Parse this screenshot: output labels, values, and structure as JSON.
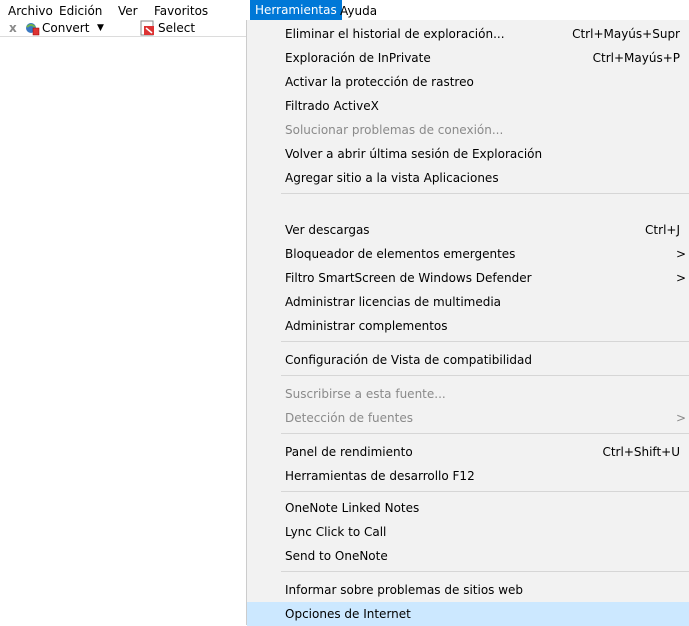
{
  "menubar": {
    "items": [
      "Archivo",
      "Edición",
      "Ver",
      "Favoritos",
      "Herramientas",
      "Ayuda"
    ]
  },
  "commandbar": {
    "close_glyph": "x",
    "convert_label": "Convert",
    "select_label": "Select",
    "convert_icon": "convert-icon",
    "select_icon": "select-icon"
  },
  "menu": {
    "items": [
      {
        "label": "Eliminar el historial de exploración...",
        "shortcut": "Ctrl+Mayús+Supr"
      },
      {
        "label": "Exploración de InPrivate",
        "shortcut": "Ctrl+Mayús+P"
      },
      {
        "label": "Activar la protección de rastreo",
        "shortcut": ""
      },
      {
        "label": "Filtrado ActiveX",
        "shortcut": ""
      },
      {
        "label": "Solucionar problemas de conexión...",
        "shortcut": "",
        "disabled": true
      },
      {
        "label": "Volver a abrir última sesión de Exploración",
        "shortcut": ""
      },
      {
        "label": "Agregar sitio a la vista Aplicaciones",
        "shortcut": ""
      },
      {
        "label": "Ver descargas",
        "shortcut": "Ctrl+J"
      },
      {
        "label": "Bloqueador de elementos emergentes",
        "shortcut": "",
        "submenu": true
      },
      {
        "label": "Filtro SmartScreen de Windows Defender",
        "shortcut": "",
        "submenu": true
      },
      {
        "label": "Administrar licencias de multimedia",
        "shortcut": ""
      },
      {
        "label": "Administrar complementos",
        "shortcut": ""
      },
      {
        "label": "Configuración de Vista de compatibilidad",
        "shortcut": ""
      },
      {
        "label": "Suscribirse a esta fuente...",
        "shortcut": "",
        "disabled": true
      },
      {
        "label": "Detección de fuentes",
        "shortcut": "",
        "disabled": true,
        "submenu": true
      },
      {
        "label": "Panel de rendimiento",
        "shortcut": "Ctrl+Shift+U"
      },
      {
        "label": "Herramientas de desarrollo F12",
        "shortcut": ""
      },
      {
        "label": "OneNote Linked Notes",
        "shortcut": ""
      },
      {
        "label": "Lync Click to Call",
        "shortcut": ""
      },
      {
        "label": "Send to OneNote",
        "shortcut": ""
      },
      {
        "label": "Informar sobre problemas de sitios web",
        "shortcut": ""
      },
      {
        "label": "Opciones de Internet",
        "shortcut": "",
        "highlighted": true
      }
    ],
    "submenu_arrow": ">"
  },
  "colors": {
    "menu_active": "#0078d7",
    "menu_bg": "#f2f2f2",
    "hover_highlight": "#cce8ff",
    "disabled_text": "#8a8a8a"
  }
}
